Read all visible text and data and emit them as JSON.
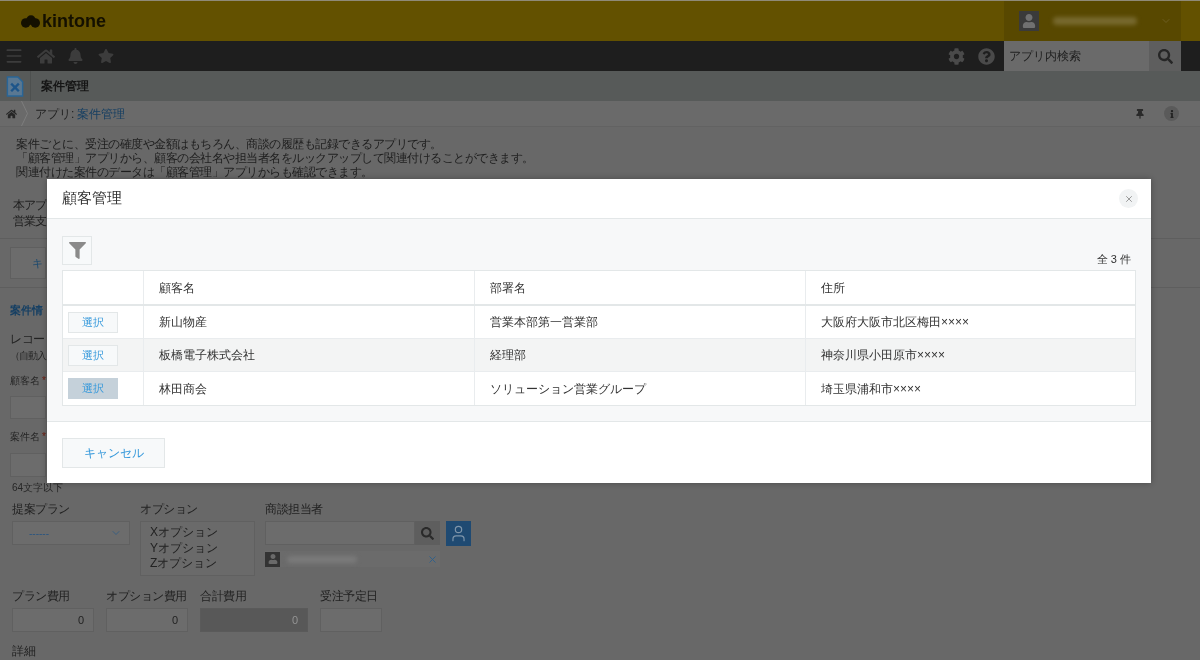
{
  "header": {
    "logo": "kintone"
  },
  "nav": {
    "search": {
      "placeholder": "アプリ内検索"
    }
  },
  "app_bar": {
    "title": "案件管理"
  },
  "breadcrumb": {
    "label": "アプリ:",
    "link": "案件管理"
  },
  "description": {
    "paragraphs": [
      [
        "案件ごとに、受注の確度や金額はもちろん、商談の履歴も記録できるアプリです。",
        "「顧客管理」アプリから、顧客の会社名や担当者名をルックアップして関連付けることができます。",
        "関連付けた案件のデータは「顧客管理」アプリからも確認できます。"
      ],
      [
        "本アプ",
        "営業支"
      ]
    ]
  },
  "toolbar": {
    "button": "キ"
  },
  "form": {
    "section_title": "案件情",
    "record_number": {
      "label": "レコー",
      "value": "（自動入"
    },
    "customer": {
      "label": "顧客名",
      "required_mark": "*"
    },
    "case_name": {
      "label": "案件名",
      "required_mark": "*",
      "hint": "64文字以下"
    },
    "row_1": [
      {
        "kind": "dropdown",
        "label": "提案プラン",
        "value": "------"
      },
      {
        "kind": "multiselect",
        "label": "オプション",
        "options": [
          "Xオプション",
          "Yオプション",
          "Zオプション"
        ]
      },
      {
        "kind": "user",
        "label": "商談担当者"
      }
    ],
    "row_2": [
      {
        "kind": "number",
        "label": "プラン費用",
        "value": "0",
        "disabled": false
      },
      {
        "kind": "number",
        "label": "オプション費用",
        "value": "0",
        "disabled": false
      },
      {
        "kind": "number",
        "label": "合計費用",
        "value": "0",
        "disabled": true
      },
      {
        "kind": "date",
        "label": "受注予定日"
      }
    ],
    "detail_label": "詳細"
  },
  "dialog": {
    "title": "顧客管理",
    "count": "全 3 件",
    "columns": [
      "顧客名",
      "部署名",
      "住所"
    ],
    "rows": [
      {
        "button": "選択",
        "hovered": false,
        "cells": [
          "新山物産",
          "営業本部第一営業部",
          "大阪府大阪市北区梅田××××"
        ]
      },
      {
        "button": "選択",
        "hovered": false,
        "cells": [
          "板橋電子株式会社",
          "経理部",
          "神奈川県小田原市××××"
        ]
      },
      {
        "button": "選択",
        "hovered": true,
        "cells": [
          "林田商会",
          "ソリューション営業グループ",
          "埼玉県浦和市××××"
        ]
      }
    ],
    "cancel": "キャンセル"
  }
}
